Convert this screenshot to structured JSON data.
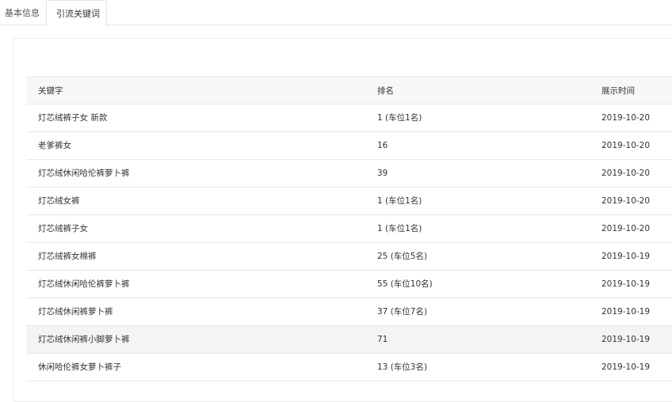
{
  "tabs": {
    "basic_info": "基本信息",
    "keywords": "引流关键词"
  },
  "table": {
    "headers": {
      "keyword": "关键字",
      "rank": "排名",
      "date": "展示时间"
    },
    "rows": [
      {
        "keyword": "灯芯绒裤子女 新款",
        "rank": "1 (车位1名)",
        "date": "2019-10-20"
      },
      {
        "keyword": "老爹裤女",
        "rank": "16",
        "date": "2019-10-20"
      },
      {
        "keyword": "灯芯绒休闲哈伦裤萝卜裤",
        "rank": "39",
        "date": "2019-10-20"
      },
      {
        "keyword": "灯芯绒女裤",
        "rank": "1 (车位1名)",
        "date": "2019-10-20"
      },
      {
        "keyword": "灯芯绒裤子女",
        "rank": "1 (车位1名)",
        "date": "2019-10-20"
      },
      {
        "keyword": "灯芯绒裤女棉裤",
        "rank": "25 (车位5名)",
        "date": "2019-10-19"
      },
      {
        "keyword": "灯芯绒休闲哈伦裤萝卜裤",
        "rank": "55 (车位10名)",
        "date": "2019-10-19"
      },
      {
        "keyword": "灯芯绒休闲裤萝卜裤",
        "rank": "37 (车位7名)",
        "date": "2019-10-19"
      },
      {
        "keyword": "灯芯绒休闲裤小脚萝卜裤",
        "rank": "71",
        "date": "2019-10-19"
      },
      {
        "keyword": "休闲哈伦裤女萝卜裤子",
        "rank": "13 (车位3名)",
        "date": "2019-10-19"
      }
    ]
  }
}
